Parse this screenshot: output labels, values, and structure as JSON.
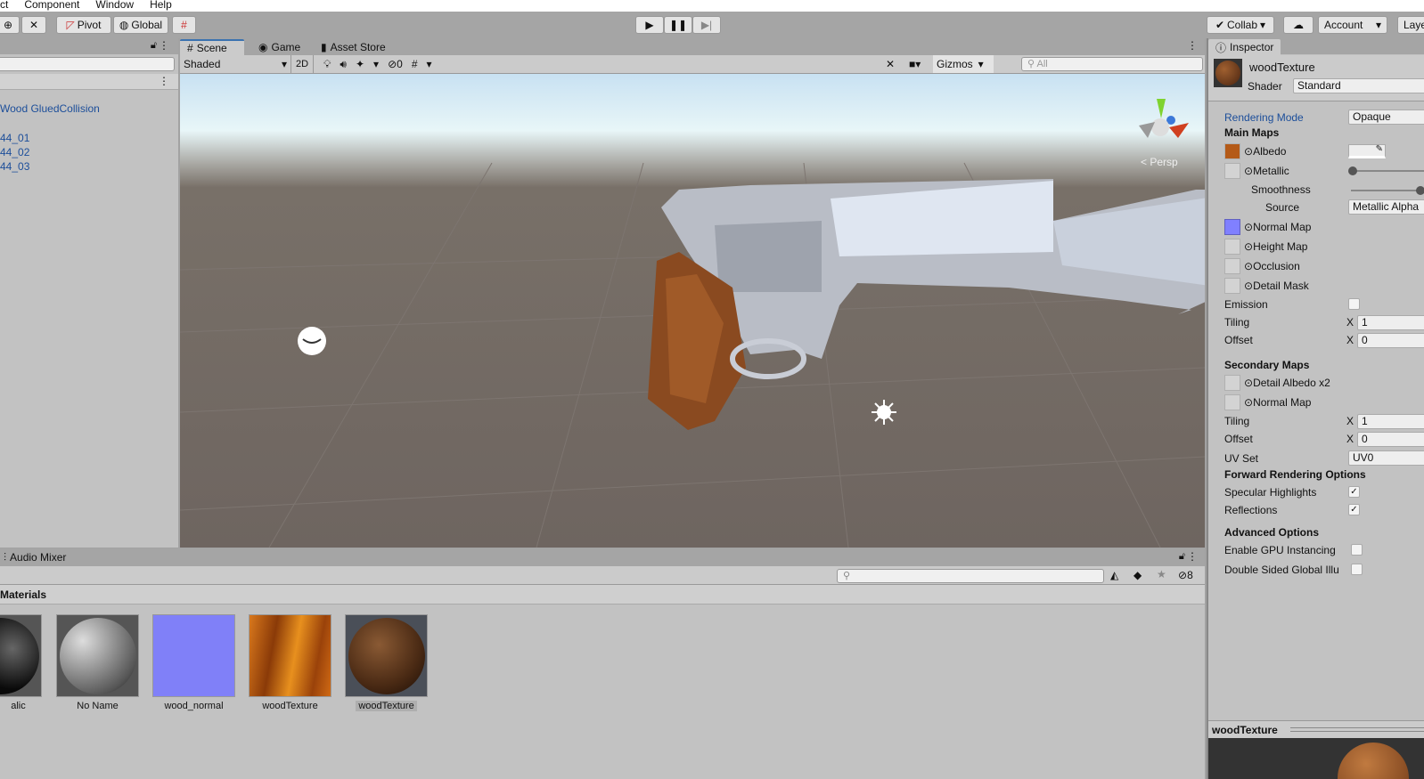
{
  "menu": [
    "ct",
    "Component",
    "Window",
    "Help"
  ],
  "toolbar": {
    "pivot": "Pivot",
    "global": "Global",
    "collab": "Collab",
    "account": "Account",
    "layers": "Laye"
  },
  "hierarchy": {
    "items": [
      "Wood GluedCollision",
      "44_01",
      "44_02",
      "44_03"
    ]
  },
  "scene": {
    "tabs": [
      "Scene",
      "Game",
      "Asset Store"
    ],
    "shading": "Shaded",
    "mode2d": "2D",
    "hidden_count": "0",
    "gizmos": "Gizmos",
    "search_placeholder": "All",
    "persp": "Persp"
  },
  "inspector": {
    "tab": "Inspector",
    "name": "woodTexture",
    "shader_label": "Shader",
    "shader": "Standard",
    "rendering_mode_label": "Rendering Mode",
    "rendering_mode": "Opaque",
    "main_maps": "Main Maps",
    "albedo": "Albedo",
    "metallic": "Metallic",
    "smoothness": "Smoothness",
    "smoothness_value": 0.95,
    "metallic_value": 0.0,
    "source_label": "Source",
    "source": "Metallic Alpha",
    "normal_map": "Normal Map",
    "height_map": "Height Map",
    "occlusion": "Occlusion",
    "detail_mask": "Detail Mask",
    "emission": "Emission",
    "tiling": "Tiling",
    "offset": "Offset",
    "x": "X",
    "tiling_x": "1",
    "offset_x": "0",
    "secondary_maps": "Secondary Maps",
    "detail_albedo": "Detail Albedo x2",
    "normal_map2": "Normal Map",
    "uv_set_label": "UV Set",
    "uv_set": "UV0",
    "forward": "Forward Rendering Options",
    "specular": "Specular Highlights",
    "reflections": "Reflections",
    "check": "✓",
    "advanced": "Advanced Options",
    "gpu": "Enable GPU Instancing",
    "double_sided": "Double Sided Global Illu",
    "preview_title": "woodTexture"
  },
  "project": {
    "tab": "Audio Mixer",
    "folder": "Materials",
    "hidden_count": "8",
    "assets": [
      {
        "label": "alic"
      },
      {
        "label": "No Name"
      },
      {
        "label": "wood_normal"
      },
      {
        "label": "woodTexture"
      },
      {
        "label": "woodTexture"
      }
    ]
  },
  "colors": {
    "accent": "#3a72b0",
    "link": "#1c4e9a"
  }
}
